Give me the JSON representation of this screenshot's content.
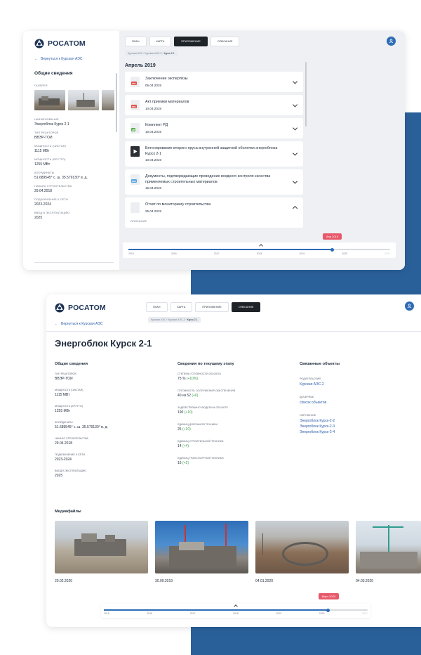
{
  "brand": {
    "name": "РОСАТОМ"
  },
  "top": {
    "back": "Вернуться к Курская АЭС",
    "section_title": "Общие сведения",
    "gallery_label": "ГАЛЕРЕЯ",
    "fields": [
      {
        "label": "НАИМЕНОВАНИЕ",
        "value": "Энергоблок Курск 2-1"
      },
      {
        "label": "ТИП РЕАКТОРОВ",
        "value": "ВВЭР-ТОИ"
      },
      {
        "label": "МОЩНОСТЬ (ЧИСТАЯ)",
        "value": "1115 МВт"
      },
      {
        "label": "МОЩНОСТЬ (БРУТТО)",
        "value": "1255 МВт"
      },
      {
        "label": "КООРДИНАТЫ",
        "value": "51.689545° с. ш. 35.579130° в. д."
      },
      {
        "label": "НАЧАЛО СТРОИТЕЛЬСТВА",
        "value": "29.04.2018"
      },
      {
        "label": "ПОДКЛЮЧЕНИЕ К СЕТИ",
        "value": "2023-2024"
      },
      {
        "label": "ВВОД В ЭКСПЛУАТАЦИЮ",
        "value": "2025"
      }
    ],
    "tabs": [
      "ПЛАН",
      "КАРТА",
      "ПРИЛОЖЕНИЕ",
      "ОПИСАНИЕ"
    ],
    "active_tab": "ПРИЛОЖЕНИЕ",
    "crumb_path": "Курская АЭС › Курская АЭС-2 › ",
    "crumb_current": "Курск 2-1",
    "month": "Апрель 2019",
    "docs": [
      {
        "type": "PDF",
        "color": "#e0534b",
        "title": "Заключение экспертизы",
        "date": "05.04.2019"
      },
      {
        "type": "PDF",
        "color": "#e0534b",
        "title": "Акт приемки материалов",
        "date": "10.04.2019"
      },
      {
        "type": "ZIP",
        "color": "#5ab04a",
        "title": "Комплект РД",
        "date": "10.04.2019"
      },
      {
        "type": "VID",
        "color": "#333",
        "title": "Бетонирование второго яруса внутренней защитной оболочки энергоблока Курск 2-1",
        "date": "10.04.2019"
      },
      {
        "type": "DOC",
        "color": "#5aa7e0",
        "title": "Документы, подтверждающие проведение входного контроля качества применяемых строительных материалов",
        "date": "15.04.2019"
      },
      {
        "type": "",
        "color": "#b9bec6",
        "title": "Отчет по мониторингу строительства",
        "date": "25.04.2019",
        "expanded_label": "ОПИСАНИЕ"
      }
    ],
    "timeline": {
      "tag": "Апр 2019",
      "years": [
        "2015",
        "2016",
        "2017",
        "2018",
        "2019",
        "2020",
        "2021"
      ],
      "progress": 0.78
    }
  },
  "bottom": {
    "back": "Вернуться к Курская АЭС",
    "tabs": [
      "ПЛАН",
      "КАРТА",
      "ПРИЛОЖЕНИЕ",
      "ОПИСАНИЕ"
    ],
    "active_tab": "ОПИСАНИЕ",
    "crumb_path": "Курская АЭС › Курская АЭС-2 › ",
    "crumb_current": "Курск 2-1",
    "title": "Энергоблок Курск 2-1",
    "general": {
      "title": "Общие сведения",
      "fields": [
        {
          "label": "ТИП РЕАКТОРОВ",
          "value": "ВВЭР-ТОИ"
        },
        {
          "label": "МОЩНОСТЬ (ЧИСТАЯ)",
          "value": "1115 МВт"
        },
        {
          "label": "МОЩНОСТЬ (БРУТТО)",
          "value": "1255 МВт"
        },
        {
          "label": "КООРДИНАТЫ",
          "value": "51.689545° с. ш. 35.579130° в. д."
        },
        {
          "label": "НАЧАЛО СТРОИТЕЛЬСТВА",
          "value": "29.04.2018"
        },
        {
          "label": "ПОДКЛЮЧЕНИЕ К СЕТИ",
          "value": "2023-2024"
        },
        {
          "label": "ВВОД В ЭКСПЛУАТАЦИЮ",
          "value": "2025"
        }
      ]
    },
    "stage": {
      "title": "Сведения по текущему этапу",
      "fields": [
        {
          "label": "СТЕПЕНЬ ГОТОВНОСТИ ОБЪЕКТА",
          "value": "75 %",
          "delta": "(+10%)"
        },
        {
          "label": "ГОТОВНОСТЬ СООРУЖЕНИЙ ОБЕСПЕЧЕНИЯ",
          "value": "40 из 52",
          "delta": "(+6)"
        },
        {
          "label": "ЗАДЕЙСТВОВАНО ЛЮДЕЙ НА ОБЪЕКТЕ",
          "value": "190",
          "delta": "(+10)"
        },
        {
          "label": "ЕДИНИЦ ДОРОЖНОЙ ТЕХНИКИ",
          "value": "25",
          "delta": "(+10)"
        },
        {
          "label": "ЕДИНИЦ СТРОИТЕЛЬНОЙ ТЕХНИКИ",
          "value": "14",
          "delta": "(+4)"
        },
        {
          "label": "ЕДИНИЦ ТРАНСПОРТНОЙ ТЕХНИКИ",
          "value": "16",
          "delta": "(+2)"
        }
      ]
    },
    "related": {
      "title": "Связанные объекты",
      "parent_label": "РОДИТЕЛЬСКИЙ",
      "parent": "Курская АЭС-2",
      "child_label": "ДОЧЕРНИЕ",
      "child": "список объектов",
      "env_label": "ОКРУЖЕНИЕ",
      "env": [
        "Энергоблок Курск-2-2",
        "Энергоблок Курск-2-3",
        "Энергоблок Курск-2-4"
      ]
    },
    "media": {
      "title": "Медиафайлы",
      "dates": [
        "20.02.2020",
        "30.09.2019",
        "04.01.2020",
        "04.03.2020"
      ]
    },
    "timeline": {
      "tag": "Март 2020",
      "years": [
        "2015",
        "2016",
        "2017",
        "2018",
        "2019",
        "2020",
        "2021"
      ],
      "progress": 0.85
    }
  }
}
